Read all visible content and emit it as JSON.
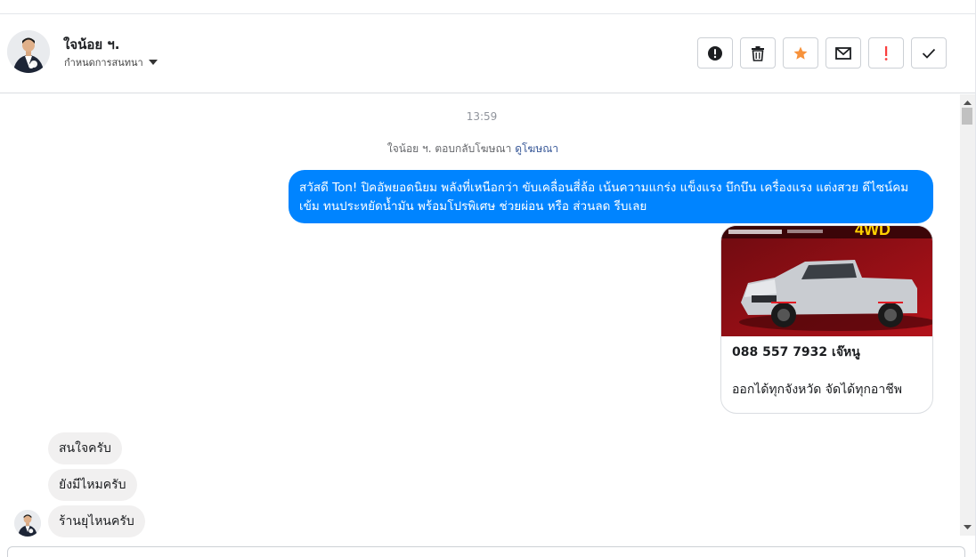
{
  "header": {
    "contact_name": "ใจน้อย ฯ.",
    "manage_label": "กำหนดการสนทนา",
    "toolbar": [
      {
        "name": "report-button",
        "icon": "exclamation-circle-icon"
      },
      {
        "name": "delete-button",
        "icon": "trash-icon"
      },
      {
        "name": "star-button",
        "icon": "star-icon"
      },
      {
        "name": "mail-button",
        "icon": "envelope-icon"
      },
      {
        "name": "spam-button",
        "icon": "exclamation-icon"
      },
      {
        "name": "done-button",
        "icon": "check-icon"
      }
    ]
  },
  "colors": {
    "outgoing_bubble": "#0084ff",
    "incoming_bubble": "#f1f0f0",
    "star": "#f7923b",
    "spam": "#fa3e3e",
    "link": "#385898"
  },
  "chat": {
    "timestamp": "13:59",
    "replied_text": "ใจน้อย ฯ. ตอบกลับโฆษณา",
    "replied_link": "ดูโฆษณา",
    "outgoing_message": "สวัสดี Ton! ปิคอัพยอดนิยม พลังที่เหนือกว่า ขับเคลื่อนสี่ล้อ เน้นความแกร่ง แข็งแรง บึกบึน เครื่องแรง แต่งสวย  ดีไซน์คมเข้ม ทนประหยัดน้ำมัน พร้อมโปรพิเศษ ช่วยผ่อน หรือ ส่วนลด รีบเลย",
    "ad_card": {
      "image_banner": "4WD",
      "title": "088 557 7932 เจ๊หนู",
      "description": "ออกได้ทุกจังหวัด จัดได้ทุกอาชีพ"
    },
    "incoming_messages": [
      "สนใจครับ",
      "ยังมีไหมครับ",
      "ร้านยุไหนครับ"
    ]
  }
}
